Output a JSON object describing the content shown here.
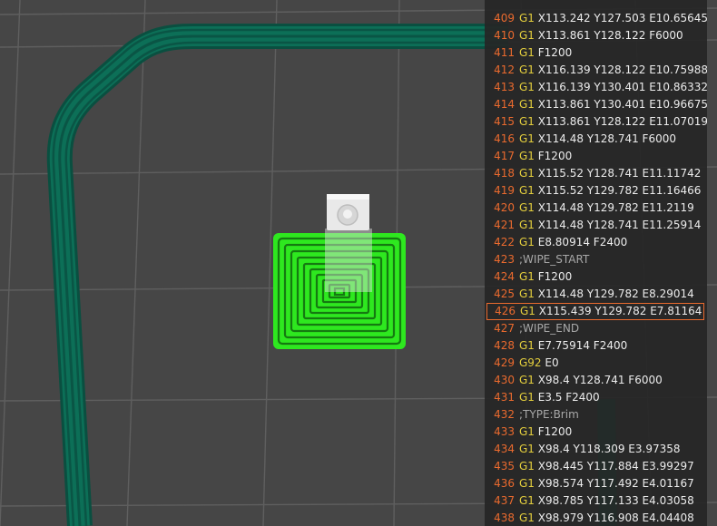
{
  "colors": {
    "background": "#464646",
    "grid": "#5e5e5e",
    "brim": "#0c6f57",
    "skirt_outer": "#0a5e4b",
    "object_fill": "#2ee81f",
    "object_outline": "#157a11",
    "line_number": "#ea6a2e",
    "g_command": "#e3ce3d",
    "selected_border": "#ea6a2e"
  },
  "gcode": {
    "selected_line": "426",
    "lines": [
      {
        "n": "409",
        "cmd": "G1",
        "args": "X113.242 Y127.503 E10.65645"
      },
      {
        "n": "410",
        "cmd": "G1",
        "args": "X113.861 Y128.122 F6000"
      },
      {
        "n": "411",
        "cmd": "G1",
        "args": "F1200"
      },
      {
        "n": "412",
        "cmd": "G1",
        "args": "X116.139 Y128.122 E10.75988"
      },
      {
        "n": "413",
        "cmd": "G1",
        "args": "X116.139 Y130.401 E10.86332"
      },
      {
        "n": "414",
        "cmd": "G1",
        "args": "X113.861 Y130.401 E10.96675"
      },
      {
        "n": "415",
        "cmd": "G1",
        "args": "X113.861 Y128.122 E11.07019"
      },
      {
        "n": "416",
        "cmd": "G1",
        "args": "X114.48 Y128.741 F6000"
      },
      {
        "n": "417",
        "cmd": "G1",
        "args": "F1200"
      },
      {
        "n": "418",
        "cmd": "G1",
        "args": "X115.52 Y128.741 E11.11742"
      },
      {
        "n": "419",
        "cmd": "G1",
        "args": "X115.52 Y129.782 E11.16466"
      },
      {
        "n": "420",
        "cmd": "G1",
        "args": "X114.48 Y129.782 E11.2119"
      },
      {
        "n": "421",
        "cmd": "G1",
        "args": "X114.48 Y128.741 E11.25914"
      },
      {
        "n": "422",
        "cmd": "G1",
        "args": "E8.80914 F2400"
      },
      {
        "n": "423",
        "cmd": "",
        "args": ";WIPE_START"
      },
      {
        "n": "424",
        "cmd": "G1",
        "args": "F1200"
      },
      {
        "n": "425",
        "cmd": "G1",
        "args": "X114.48 Y129.782 E8.29014"
      },
      {
        "n": "426",
        "cmd": "G1",
        "args": "X115.439 Y129.782 E7.81164"
      },
      {
        "n": "427",
        "cmd": "",
        "args": ";WIPE_END"
      },
      {
        "n": "428",
        "cmd": "G1",
        "args": "E7.75914 F2400"
      },
      {
        "n": "429",
        "cmd": "G92",
        "args": "E0"
      },
      {
        "n": "430",
        "cmd": "G1",
        "args": "X98.4 Y128.741 F6000"
      },
      {
        "n": "431",
        "cmd": "G1",
        "args": "E3.5 F2400"
      },
      {
        "n": "432",
        "cmd": "",
        "args": ";TYPE:Brim"
      },
      {
        "n": "433",
        "cmd": "G1",
        "args": "F1200"
      },
      {
        "n": "434",
        "cmd": "G1",
        "args": "X98.4 Y118.309 E3.97358"
      },
      {
        "n": "435",
        "cmd": "G1",
        "args": "X98.445 Y117.884 E3.99297"
      },
      {
        "n": "436",
        "cmd": "G1",
        "args": "X98.574 Y117.492 E4.01167"
      },
      {
        "n": "437",
        "cmd": "G1",
        "args": "X98.785 Y117.133 E4.03058"
      },
      {
        "n": "438",
        "cmd": "G1",
        "args": "X98.979 Y116.908 E4.04408"
      }
    ]
  }
}
